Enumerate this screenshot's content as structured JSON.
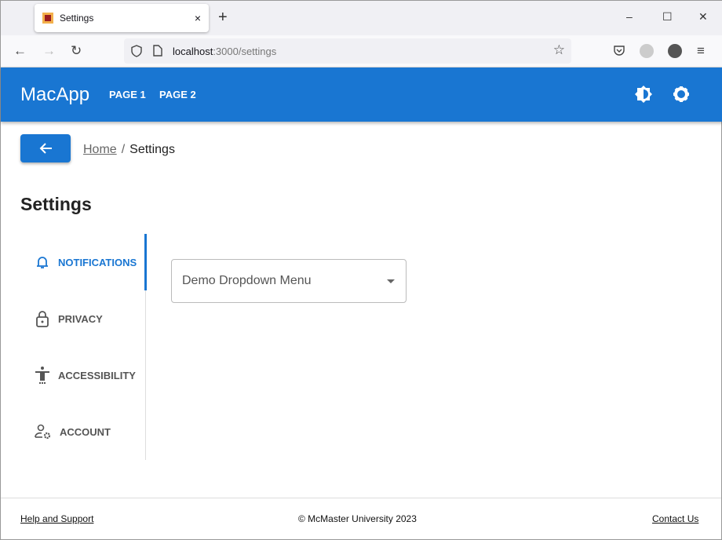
{
  "browser": {
    "tab_title": "Settings",
    "tab_close": "×",
    "new_tab": "+",
    "url_host": "localhost",
    "url_rest": ":3000/settings",
    "minimize": "–",
    "maximize": "☐",
    "close": "✕"
  },
  "header": {
    "brand": "MacApp",
    "nav": [
      "PAGE 1",
      "PAGE 2"
    ]
  },
  "breadcrumb": {
    "home": "Home",
    "separator": "/",
    "current": "Settings"
  },
  "page": {
    "title": "Settings"
  },
  "sidebar": {
    "items": [
      {
        "label": "NOTIFICATIONS",
        "icon": "bell-icon",
        "active": true
      },
      {
        "label": "PRIVACY",
        "icon": "lock-icon"
      },
      {
        "label": "ACCESSIBILITY",
        "icon": "accessibility-icon"
      },
      {
        "label": "ACCOUNT",
        "icon": "account-settings-icon"
      }
    ]
  },
  "dropdown": {
    "label": "Demo Dropdown Menu"
  },
  "footer": {
    "help": "Help and Support",
    "copyright": "© McMaster University 2023",
    "contact": "Contact Us"
  },
  "colors": {
    "primary": "#1976d2"
  }
}
